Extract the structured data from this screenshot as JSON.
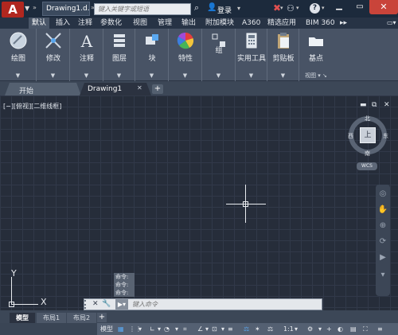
{
  "app": {
    "logo": "A",
    "doc_tab": "Drawing1.d...",
    "search_placeholder": "键入关键字或短语",
    "login": "登录"
  },
  "ribbon_tabs": [
    "默认",
    "插入",
    "注释",
    "参数化",
    "视图",
    "管理",
    "输出",
    "附加模块",
    "A360",
    "精选应用",
    "BIM 360"
  ],
  "ribbon_groups": [
    {
      "label": "绘图"
    },
    {
      "label": "修改"
    },
    {
      "label": "注释"
    },
    {
      "label": "图层"
    },
    {
      "label": "块"
    },
    {
      "label": "特性"
    },
    {
      "label": "组"
    },
    {
      "label": "实用工具"
    },
    {
      "label": "剪贴板"
    },
    {
      "label": "基点",
      "footer": "视图"
    }
  ],
  "file_tabs": {
    "start": "开始",
    "drawing": "Drawing1"
  },
  "viewport": {
    "label": "[−][俯视][二维线框]",
    "cube_face": "上",
    "north": "北",
    "south": "南",
    "east": "东",
    "west": "西",
    "wcs": "WCS"
  },
  "ucs": {
    "x": "X",
    "y": "Y"
  },
  "command": {
    "history": [
      "命令:",
      "命令:",
      "命令:"
    ],
    "placeholder": "键入命令"
  },
  "layout_tabs": [
    "模型",
    "布局1",
    "布局2"
  ],
  "status": {
    "model": "模型",
    "scale": "1:1"
  },
  "icons": [
    "search-icon",
    "user-icon",
    "exchange-icon",
    "a360-icon",
    "help-icon",
    "minimize-icon",
    "maximize-icon",
    "close-icon"
  ]
}
